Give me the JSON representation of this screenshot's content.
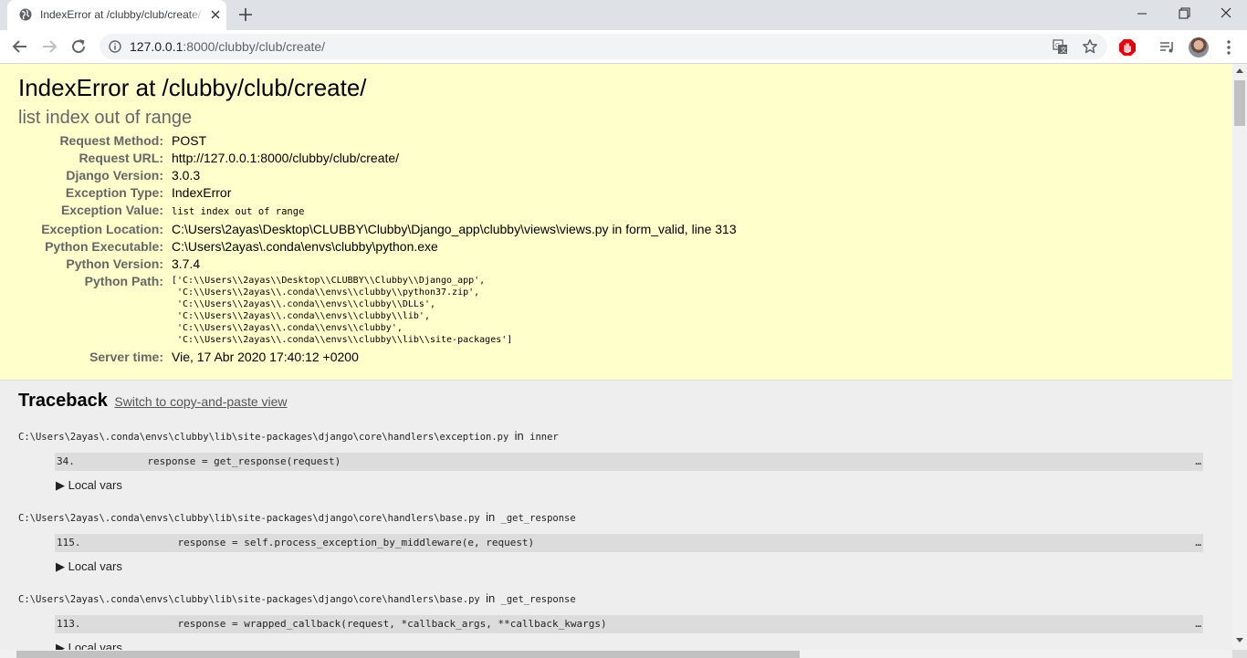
{
  "browser": {
    "tab_title": "IndexError at /clubby/club/create/",
    "url_host": "127.0.0.1",
    "url_rest": ":8000/clubby/club/create/",
    "icons": {
      "favicon": "globe-icon",
      "tab_close": "close-icon",
      "new_tab": "plus-icon",
      "back": "back-arrow-icon",
      "forward": "forward-arrow-icon",
      "reload": "reload-icon",
      "site_info": "info-icon",
      "translate": "translate-icon",
      "bookmark": "star-icon",
      "adblock": "adblock-icon",
      "media": "media-queue-icon",
      "menu": "kebab-menu-icon"
    }
  },
  "page": {
    "title": "IndexError at /clubby/club/create/",
    "subtitle": "list index out of range",
    "meta": [
      {
        "label": "Request Method:",
        "value": "POST",
        "kind": "text"
      },
      {
        "label": "Request URL:",
        "value": "http://127.0.0.1:8000/clubby/club/create/",
        "kind": "text"
      },
      {
        "label": "Django Version:",
        "value": "3.0.3",
        "kind": "text"
      },
      {
        "label": "Exception Type:",
        "value": "IndexError",
        "kind": "text"
      },
      {
        "label": "Exception Value:",
        "value": "list index out of range",
        "kind": "code"
      },
      {
        "label": "Exception Location:",
        "value": "C:\\Users\\2ayas\\Desktop\\CLUBBY\\Clubby\\Django_app\\clubby\\views\\views.py in form_valid, line 313",
        "kind": "text"
      },
      {
        "label": "Python Executable:",
        "value": "C:\\Users\\2ayas\\.conda\\envs\\clubby\\python.exe",
        "kind": "text"
      },
      {
        "label": "Python Version:",
        "value": "3.7.4",
        "kind": "text"
      },
      {
        "label": "Python Path:",
        "value": "['C:\\\\Users\\\\2ayas\\\\Desktop\\\\CLUBBY\\\\Clubby\\\\Django_app',\n 'C:\\\\Users\\\\2ayas\\\\.conda\\\\envs\\\\clubby\\\\python37.zip',\n 'C:\\\\Users\\\\2ayas\\\\.conda\\\\envs\\\\clubby\\\\DLLs',\n 'C:\\\\Users\\\\2ayas\\\\.conda\\\\envs\\\\clubby\\\\lib',\n 'C:\\\\Users\\\\2ayas\\\\.conda\\\\envs\\\\clubby',\n 'C:\\\\Users\\\\2ayas\\\\.conda\\\\envs\\\\clubby\\\\lib\\\\site-packages']",
        "kind": "pre"
      },
      {
        "label": "Server time:",
        "value": "Vie, 17 Abr 2020 17:40:12 +0200",
        "kind": "text"
      }
    ]
  },
  "traceback": {
    "heading": "Traceback",
    "switch_link": "Switch to copy-and-paste view",
    "in_word": "in",
    "local_vars_label": "▶ Local vars",
    "ellipsis": "…",
    "frames": [
      {
        "file": "C:\\Users\\2ayas\\.conda\\envs\\clubby\\lib\\site-packages\\django\\core\\handlers\\exception.py",
        "func": "inner",
        "line": "34.            response = get_response(request)"
      },
      {
        "file": "C:\\Users\\2ayas\\.conda\\envs\\clubby\\lib\\site-packages\\django\\core\\handlers\\base.py",
        "func": "_get_response",
        "line": "115.                response = self.process_exception_by_middleware(e, request)"
      },
      {
        "file": "C:\\Users\\2ayas\\.conda\\envs\\clubby\\lib\\site-packages\\django\\core\\handlers\\base.py",
        "func": "_get_response",
        "line": "113.                response = wrapped_callback(request, *callback_args, **callback_kwargs)"
      }
    ]
  },
  "colors": {
    "summary_bg": "#ffffcc",
    "page_bg": "#eeeeee",
    "code_bg": "#dcdcdc",
    "tab_strip": "#dee1e6",
    "adblock_red": "#e8000b"
  }
}
